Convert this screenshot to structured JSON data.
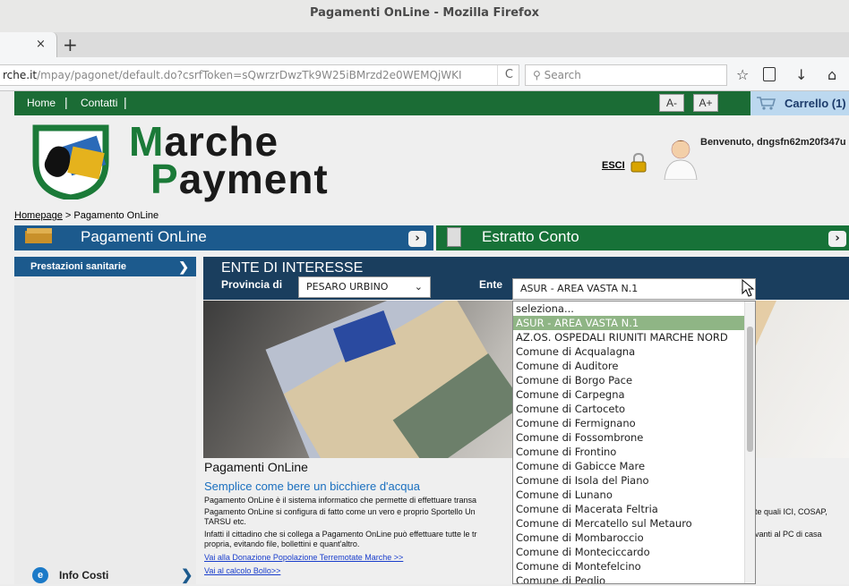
{
  "window": {
    "title": "Pagamenti OnLine - Mozilla Firefox"
  },
  "tabs": {
    "close_icon": "×",
    "new_tab_icon": "+"
  },
  "address_bar": {
    "host": "rche.it",
    "path": "/mpay/pagonet/default.do?csrfToken=sQwrzrDwzTk9W25iBMrzd2e0WEMQjWKI",
    "reload_icon": "C"
  },
  "search": {
    "placeholder": "Search"
  },
  "topnav": {
    "home": "Home",
    "contatti": "Contatti",
    "sep": "|",
    "font_minus": "A-",
    "font_plus": "A+",
    "cart": "Carrello (1)"
  },
  "header": {
    "logo_line1_first": "M",
    "logo_line1_rest": "arche",
    "logo_line2_first": "P",
    "logo_line2_rest": "ayment",
    "esci": "ESCI",
    "welcome": "Benvenuto, dngsfn62m20f347u"
  },
  "breadcrumb": {
    "home": "Homepage",
    "current": " > Pagamento OnLine"
  },
  "bars": {
    "pagamenti": "Pagamenti OnLine",
    "estratto": "Estratto Conto",
    "arrow": "›"
  },
  "sidebar": {
    "item": "Prestazioni sanitarie",
    "info_costi": "Info Costi"
  },
  "filter": {
    "heading": "ENTE DI INTERESSE",
    "provincia_label": "Provincia di",
    "provincia_value": "PESARO URBINO",
    "ente_label": "Ente",
    "ente_value": "ASUR - AREA VASTA N.1"
  },
  "content": {
    "title": "Pagamenti OnLine",
    "subtitle": "Semplice come bere un bicchiere d'acqua",
    "p1": "Pagamento OnLine è il sistema informatico che permette di effettuare transa",
    "p2": "Pagamento OnLine si configura di fatto come un vero e proprio Sportello Un",
    "p2_right": "te quali ICI, COSAP,",
    "p3": "TARSU etc.",
    "p4": "Infatti il cittadino che si collega a Pagamento OnLine può effettuare tutte le tr",
    "p4_right": "vanti al PC di casa",
    "p5": "propria, evitando file, bollettini e quant'altro.",
    "link1": "Vai alla Donazione Popolazione Terremotate Marche >>",
    "link2": "Vai al calcolo Bollo>>"
  },
  "dropdown": {
    "options": [
      "seleziona...",
      "ASUR - AREA VASTA N.1",
      "AZ.OS. OSPEDALI RIUNITI MARCHE NORD",
      "Comune di Acqualagna",
      "Comune di Auditore",
      "Comune di Borgo Pace",
      "Comune di Carpegna",
      "Comune di Cartoceto",
      "Comune di Fermignano",
      "Comune di Fossombrone",
      "Comune di Frontino",
      "Comune di Gabicce Mare",
      "Comune di Isola del Piano",
      "Comune di Lunano",
      "Comune di Macerata Feltria",
      "Comune di Mercatello sul Metauro",
      "Comune di Mombaroccio",
      "Comune di Monteciccardo",
      "Comune di Montefelcino",
      "Comune di Peglio"
    ],
    "selected_index": 1
  }
}
